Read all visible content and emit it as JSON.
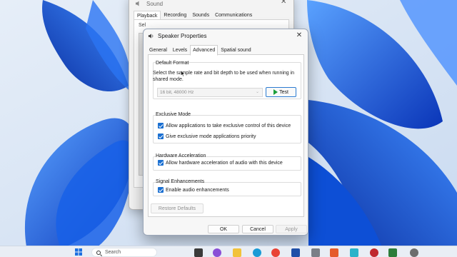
{
  "sound_window": {
    "title": "Sound",
    "tabs": [
      "Playback",
      "Recording",
      "Sounds",
      "Communications"
    ],
    "body_text": "Sel"
  },
  "dialog": {
    "title": "Speaker Properties",
    "tabs": [
      "General",
      "Levels",
      "Advanced",
      "Spatial sound"
    ],
    "active_tab": "Advanced",
    "default_format": {
      "label": "Default Format",
      "description": "Select the sample rate and bit depth to be used when running in shared mode.",
      "select_value": "16 bit, 48000 Hz",
      "test_label": "Test"
    },
    "exclusive_mode": {
      "label": "Exclusive Mode",
      "allow_exclusive": "Allow applications to take exclusive control of this device",
      "give_priority": "Give exclusive mode applications priority"
    },
    "hardware_acceleration": {
      "label": "Hardware Acceleration",
      "allow_hw": "Allow hardware acceleration of audio with this device"
    },
    "signal_enhancements": {
      "label": "Signal Enhancements",
      "enable": "Enable audio enhancements"
    },
    "restore_label": "Restore Defaults",
    "ok_label": "OK",
    "cancel_label": "Cancel",
    "apply_label": "Apply"
  },
  "taskbar": {
    "search_placeholder": "Search"
  },
  "colors": {
    "accent": "#1a6fd1",
    "test_play": "#1b9e3a",
    "wallpaper_blue": "#0d4fd6"
  }
}
